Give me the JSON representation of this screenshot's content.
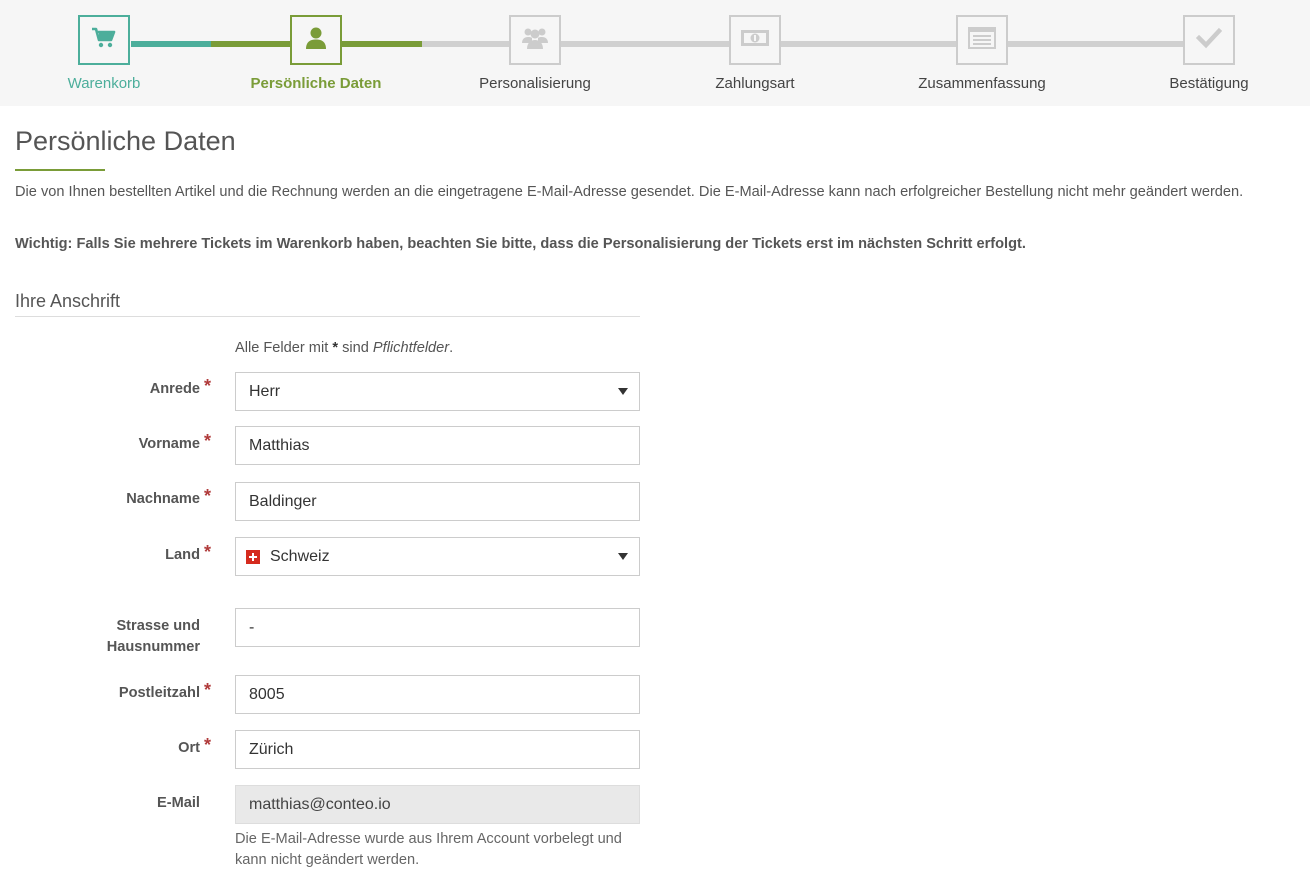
{
  "stepper": {
    "steps": [
      {
        "label": "Warenkorb",
        "icon": "shopping-cart-icon",
        "state": "done"
      },
      {
        "label": "Persönliche Daten",
        "icon": "user-icon",
        "state": "active"
      },
      {
        "label": "Personalisierung",
        "icon": "users-icon",
        "state": "todo"
      },
      {
        "label": "Zahlungsart",
        "icon": "banknote-icon",
        "state": "todo"
      },
      {
        "label": "Zusammenfassung",
        "icon": "list-icon",
        "state": "todo"
      },
      {
        "label": "Bestätigung",
        "icon": "checkmark-icon",
        "state": "todo"
      }
    ],
    "colors": {
      "done": "#4cae9b",
      "active": "#7a9c38",
      "todo": "#cccccc"
    }
  },
  "page": {
    "title": "Persönliche Daten",
    "intro": "Die von Ihnen bestellten Artikel und die Rechnung werden an die eingetragene E-Mail-Adresse gesendet. Die E-Mail-Adresse kann nach erfolgreicher Bestellung nicht mehr geändert werden.",
    "important": "Wichtig: Falls Sie mehrere Tickets im Warenkorb haben, beachten Sie bitte, dass die Personalisierung der Tickets erst im nächsten Schritt erfolgt."
  },
  "address": {
    "section_title": "Ihre Anschrift",
    "required_note": {
      "prefix": "Alle Felder mit ",
      "star": "*",
      "middle": " sind ",
      "emph": "Pflichtfelder",
      "suffix": "."
    },
    "required_marker": "*",
    "fields": {
      "anrede": {
        "label": "Anrede",
        "value": "Herr"
      },
      "vorname": {
        "label": "Vorname",
        "value": "Matthias"
      },
      "nachname": {
        "label": "Nachname",
        "value": "Baldinger"
      },
      "land": {
        "label": "Land",
        "value": "Schweiz",
        "flag_icon": "swiss-flag-icon"
      },
      "strasse": {
        "label_line1": "Strasse und",
        "label_line2": "Hausnummer",
        "value": "-"
      },
      "plz": {
        "label": "Postleitzahl",
        "value": "8005"
      },
      "ort": {
        "label": "Ort",
        "value": "Zürich"
      },
      "email": {
        "label": "E-Mail",
        "value": "matthias@conteo.io",
        "help": "Die E-Mail-Adresse wurde aus Ihrem Account vorbelegt und kann nicht geändert werden."
      }
    }
  }
}
